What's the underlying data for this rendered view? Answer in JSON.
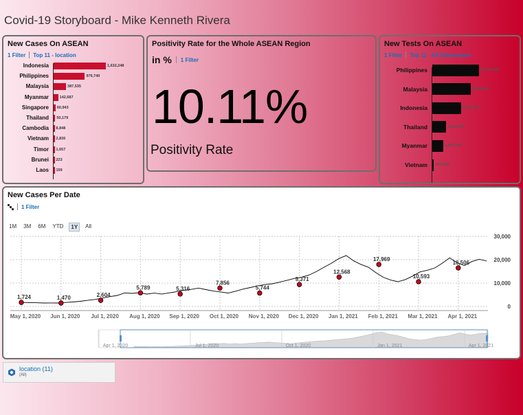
{
  "page": {
    "title": "Covid-19 Storyboard - Mike Kenneth Rivera"
  },
  "cases_card": {
    "title": "New Cases On ASEAN",
    "filter_count": "1 Filter",
    "filter_desc": "Top 11 - location",
    "bar_color": "#c8102e",
    "chart_data": {
      "type": "bar",
      "orientation": "horizontal",
      "categories": [
        "Indonesia",
        "Philippines",
        "Malaysia",
        "Myanmar",
        "Singapore",
        "Thailand",
        "Cambodia",
        "Vietnam",
        "Timor",
        "Brunei",
        "Laos"
      ],
      "values": [
        1632248,
        976740,
        387535,
        142687,
        60943,
        50179,
        8848,
        2830,
        1657,
        223,
        159
      ],
      "labels": [
        "1,632,248",
        "976,740",
        "387,535",
        "142,687",
        "60,943",
        "50,179",
        "8,848",
        "2,830",
        "1,657",
        "223",
        "159"
      ],
      "xlim": [
        0,
        1632248
      ]
    }
  },
  "positivity_card": {
    "title": "Positivity Rate for the Whole ASEAN Region",
    "unit": "in %",
    "filter_count": "1 Filter",
    "value": "10.11%",
    "caption": "Positivity Rate"
  },
  "tests_card": {
    "title": "New Tests On ASEAN",
    "filter_count": "1 Filter",
    "filter_desc": "Top 11 - All Dimensions",
    "bar_color": "#0a0a0a",
    "chart_data": {
      "type": "bar",
      "orientation": "horizontal",
      "categories": [
        "Philippines",
        "Malaysia",
        "Indonesia",
        "Thailand",
        "Myanmar",
        "Vietnam"
      ],
      "values": [
        10765000,
        8859000,
        6650000,
        3163000,
        2487000,
        391000
      ],
      "labels": [
        "10,765,000",
        "8,859,000",
        "6,650,000",
        "3,163,000",
        "2,487,000",
        "391,000"
      ],
      "xlim": [
        0,
        10765000
      ]
    }
  },
  "timeline_card": {
    "title": "New Cases Per Date",
    "filter_count": "1 Filter",
    "range_buttons": [
      "1M",
      "3M",
      "6M",
      "YTD",
      "1Y",
      "All"
    ],
    "active_range": "1Y",
    "line_color": "#000000",
    "marker_color": "#c8001e",
    "chart_data": {
      "type": "line",
      "x_tick_labels": [
        "May 1, 2020",
        "Jun 1, 2020",
        "Jul 1, 2020",
        "Aug 1, 2020",
        "Sep 1, 2020",
        "Oct 1, 2020",
        "Nov 1, 2020",
        "Dec 1, 2020",
        "Jan 1, 2021",
        "Feb 1, 2021",
        "Mar 1, 2021",
        "Apr 1, 2021"
      ],
      "y_tick_labels": [
        "0",
        "10,000",
        "20,000",
        "30,000"
      ],
      "ylim": [
        0,
        30000
      ],
      "grid": true,
      "monthly_points": [
        1724,
        1470,
        2604,
        5789,
        5316,
        7856,
        5744,
        9371,
        12568,
        17969,
        10593,
        16506
      ],
      "point_labels": [
        "1,724",
        "1,470",
        "2,604",
        "5,789",
        "5,316",
        "7,856",
        "5,744",
        "9,371",
        "12,568",
        "17,969",
        "10,593",
        "16,506"
      ],
      "daily_series": [
        1724,
        1650,
        1600,
        1480,
        1500,
        1470,
        1700,
        1900,
        2200,
        2604,
        3000,
        3600,
        4200,
        4700,
        5789,
        5600,
        5900,
        5300,
        5700,
        5316,
        5800,
        6300,
        6900,
        7300,
        7856,
        7200,
        6600,
        6200,
        5744,
        6500,
        7400,
        8100,
        8800,
        9371,
        9700,
        10400,
        11200,
        12000,
        12568,
        13500,
        15000,
        16800,
        18500,
        20500,
        21800,
        19500,
        17969,
        16800,
        14500,
        12500,
        11300,
        10593,
        11500,
        13000,
        14800,
        15500,
        16506,
        18500,
        20800,
        18800,
        17500,
        19200,
        20200,
        19400
      ]
    },
    "navigator": {
      "tick_labels": [
        "Apr 1, 2020",
        "Jul 1, 2020",
        "Oct 1, 2020",
        "Jan 1, 2021",
        "Apr 1, 2021"
      ],
      "area_color": "#d9d9d9",
      "handle_color": "#5b8fc7"
    }
  },
  "filter_panel": {
    "icon": "location-filter-icon",
    "name": "location (11)",
    "value": "(All)"
  }
}
